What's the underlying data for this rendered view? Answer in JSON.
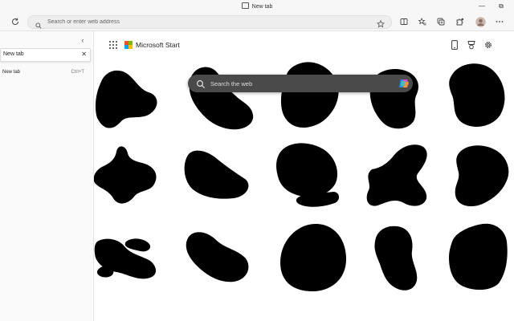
{
  "window": {
    "title": "New tab",
    "minimize_glyph": "—",
    "restore_glyph": "⧉"
  },
  "toolbar": {
    "address_placeholder": "Search or enter web address"
  },
  "sidebar": {
    "tabs": [
      {
        "label": "New tab"
      }
    ],
    "new_tab_label": "New tab",
    "new_tab_shortcut": "Ctrl+T"
  },
  "newtab_page": {
    "brand_name": "Microsoft Start",
    "search_placeholder": "Search the web"
  },
  "icons": {
    "refresh": "refresh-icon",
    "favorite": "star-icon",
    "split_screen": "split-screen-icon",
    "favorites_list": "favorites-icon",
    "collections": "collections-icon",
    "extensions": "extensions-icon",
    "profile": "profile-avatar",
    "more": "more-icon",
    "phone": "phone-icon",
    "rewards": "rewards-icon",
    "settings": "gear-icon"
  },
  "colors": {
    "ms_red": "#f25022",
    "ms_green": "#7fba00",
    "ms_blue": "#00a4ef",
    "ms_yellow": "#ffb900",
    "search_bg": "#4a4a4a"
  }
}
